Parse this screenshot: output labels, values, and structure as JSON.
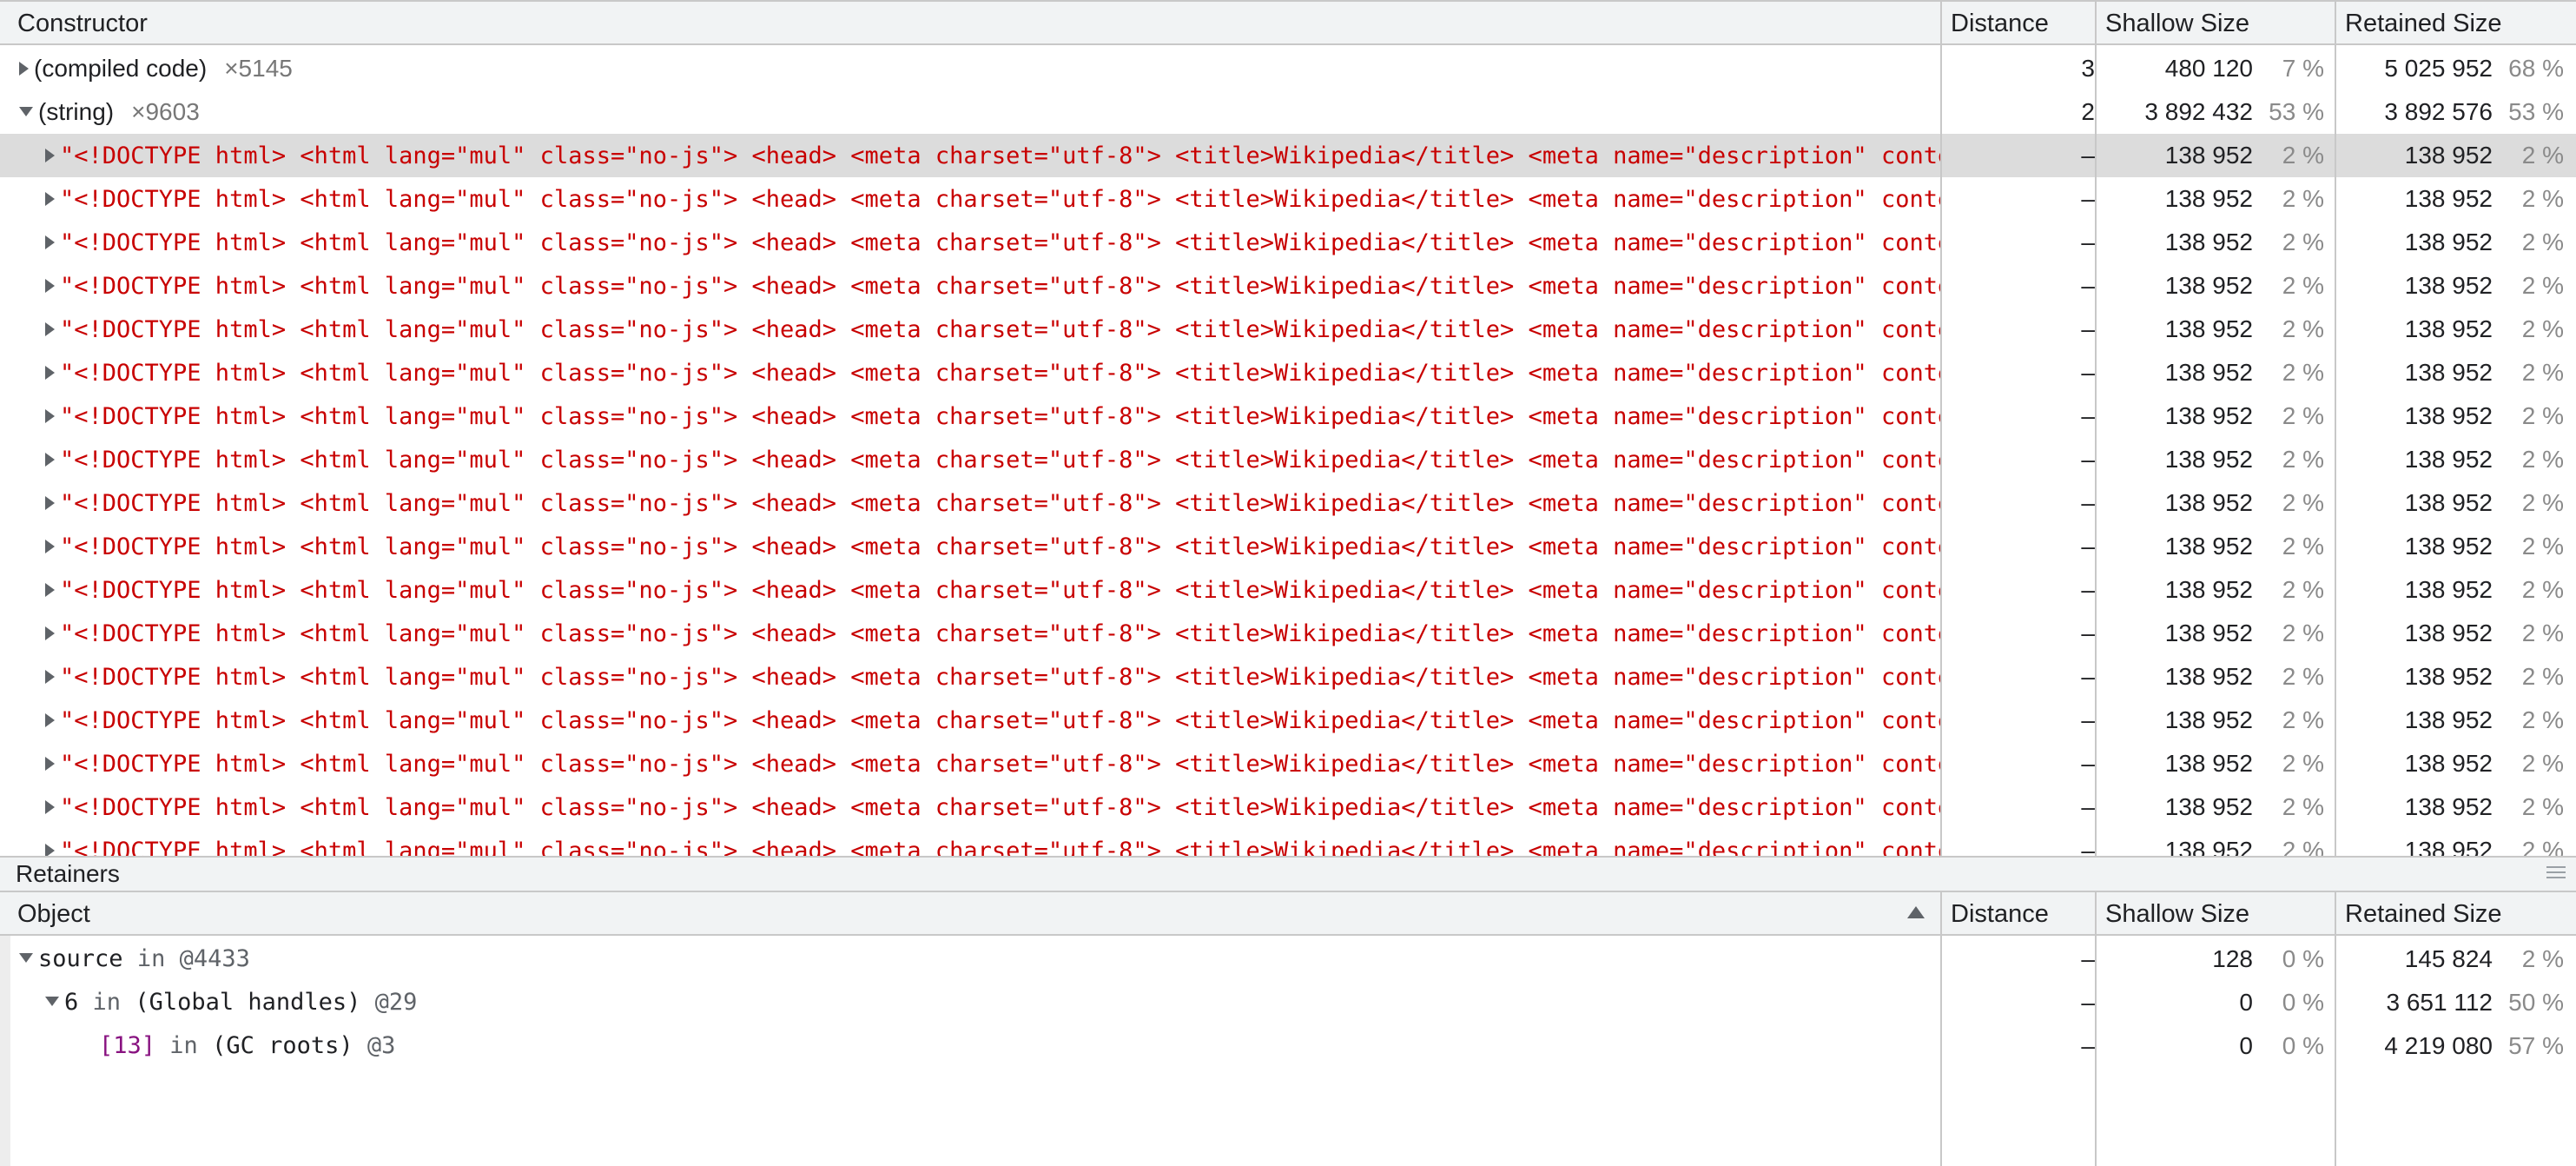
{
  "constructor_header": {
    "name": "Constructor",
    "distance": "Distance",
    "shallow": "Shallow Size",
    "retained": "Retained Size"
  },
  "groups": [
    {
      "name": "(compiled code)",
      "count": "×5145",
      "distance": "3",
      "shallow": "480 120",
      "shallow_pct": "7 %",
      "retained": "5 025 952",
      "retained_pct": "68 %",
      "expanded": false
    },
    {
      "name": "(string)",
      "count": "×9603",
      "distance": "2",
      "shallow": "3 892 432",
      "shallow_pct": "53 %",
      "retained": "3 892 576",
      "retained_pct": "53 %",
      "expanded": true
    }
  ],
  "string_rows": {
    "text": "\"<!DOCTYPE html> <html lang=\"mul\" class=\"no-js\"> <head> <meta charset=\"utf-8\"> <title>Wikipedia</title> <meta name=\"description\" content=\"Wikipedia is a free online encyclopedia",
    "distance": "–",
    "shallow": "138 952",
    "shallow_pct": "2 %",
    "retained": "138 952",
    "retained_pct": "2 %"
  },
  "retainers": {
    "title": "Retainers",
    "header": {
      "name": "Object",
      "distance": "Distance",
      "shallow": "Shallow Size",
      "retained": "Retained Size"
    },
    "rows": [
      {
        "prop": "source",
        "in": "in",
        "obj": "",
        "id": "@4433",
        "distance": "–",
        "shallow": "128",
        "shallow_pct": "0 %",
        "retained": "145 824",
        "retained_pct": "2 %"
      },
      {
        "prop": "6",
        "in": "in",
        "obj": "(Global handles)",
        "id": "@29",
        "distance": "–",
        "shallow": "0",
        "shallow_pct": "0 %",
        "retained": "3 651 112",
        "retained_pct": "50 %"
      },
      {
        "prop": "[13]",
        "in": "in",
        "obj": "(GC roots)",
        "id": "@3",
        "distance": "–",
        "shallow": "0",
        "shallow_pct": "0 %",
        "retained": "4 219 080",
        "retained_pct": "57 %"
      }
    ]
  }
}
